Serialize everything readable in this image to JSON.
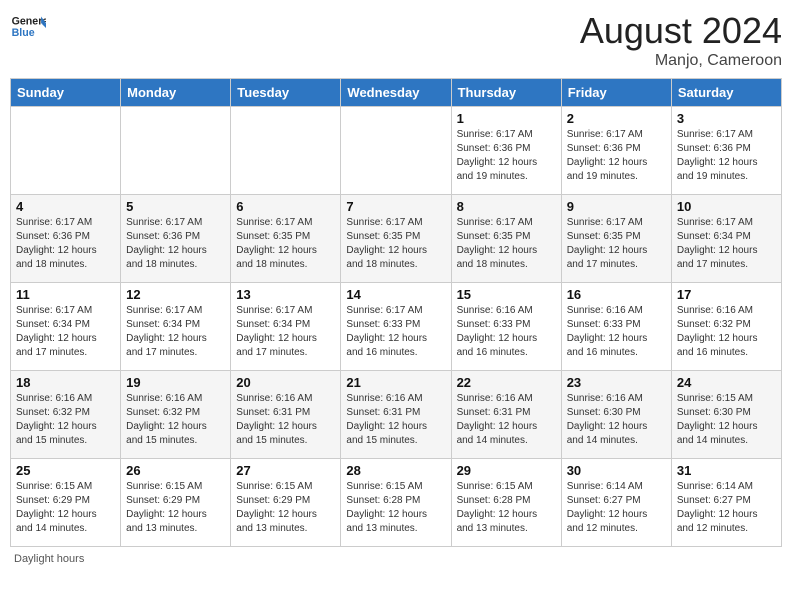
{
  "header": {
    "logo_general": "General",
    "logo_blue": "Blue",
    "month_year": "August 2024",
    "location": "Manjo, Cameroon"
  },
  "days_of_week": [
    "Sunday",
    "Monday",
    "Tuesday",
    "Wednesday",
    "Thursday",
    "Friday",
    "Saturday"
  ],
  "weeks": [
    [
      {
        "day": "",
        "info": ""
      },
      {
        "day": "",
        "info": ""
      },
      {
        "day": "",
        "info": ""
      },
      {
        "day": "",
        "info": ""
      },
      {
        "day": "1",
        "info": "Sunrise: 6:17 AM\nSunset: 6:36 PM\nDaylight: 12 hours\nand 19 minutes."
      },
      {
        "day": "2",
        "info": "Sunrise: 6:17 AM\nSunset: 6:36 PM\nDaylight: 12 hours\nand 19 minutes."
      },
      {
        "day": "3",
        "info": "Sunrise: 6:17 AM\nSunset: 6:36 PM\nDaylight: 12 hours\nand 19 minutes."
      }
    ],
    [
      {
        "day": "4",
        "info": "Sunrise: 6:17 AM\nSunset: 6:36 PM\nDaylight: 12 hours\nand 18 minutes."
      },
      {
        "day": "5",
        "info": "Sunrise: 6:17 AM\nSunset: 6:36 PM\nDaylight: 12 hours\nand 18 minutes."
      },
      {
        "day": "6",
        "info": "Sunrise: 6:17 AM\nSunset: 6:35 PM\nDaylight: 12 hours\nand 18 minutes."
      },
      {
        "day": "7",
        "info": "Sunrise: 6:17 AM\nSunset: 6:35 PM\nDaylight: 12 hours\nand 18 minutes."
      },
      {
        "day": "8",
        "info": "Sunrise: 6:17 AM\nSunset: 6:35 PM\nDaylight: 12 hours\nand 18 minutes."
      },
      {
        "day": "9",
        "info": "Sunrise: 6:17 AM\nSunset: 6:35 PM\nDaylight: 12 hours\nand 17 minutes."
      },
      {
        "day": "10",
        "info": "Sunrise: 6:17 AM\nSunset: 6:34 PM\nDaylight: 12 hours\nand 17 minutes."
      }
    ],
    [
      {
        "day": "11",
        "info": "Sunrise: 6:17 AM\nSunset: 6:34 PM\nDaylight: 12 hours\nand 17 minutes."
      },
      {
        "day": "12",
        "info": "Sunrise: 6:17 AM\nSunset: 6:34 PM\nDaylight: 12 hours\nand 17 minutes."
      },
      {
        "day": "13",
        "info": "Sunrise: 6:17 AM\nSunset: 6:34 PM\nDaylight: 12 hours\nand 17 minutes."
      },
      {
        "day": "14",
        "info": "Sunrise: 6:17 AM\nSunset: 6:33 PM\nDaylight: 12 hours\nand 16 minutes."
      },
      {
        "day": "15",
        "info": "Sunrise: 6:16 AM\nSunset: 6:33 PM\nDaylight: 12 hours\nand 16 minutes."
      },
      {
        "day": "16",
        "info": "Sunrise: 6:16 AM\nSunset: 6:33 PM\nDaylight: 12 hours\nand 16 minutes."
      },
      {
        "day": "17",
        "info": "Sunrise: 6:16 AM\nSunset: 6:32 PM\nDaylight: 12 hours\nand 16 minutes."
      }
    ],
    [
      {
        "day": "18",
        "info": "Sunrise: 6:16 AM\nSunset: 6:32 PM\nDaylight: 12 hours\nand 15 minutes."
      },
      {
        "day": "19",
        "info": "Sunrise: 6:16 AM\nSunset: 6:32 PM\nDaylight: 12 hours\nand 15 minutes."
      },
      {
        "day": "20",
        "info": "Sunrise: 6:16 AM\nSunset: 6:31 PM\nDaylight: 12 hours\nand 15 minutes."
      },
      {
        "day": "21",
        "info": "Sunrise: 6:16 AM\nSunset: 6:31 PM\nDaylight: 12 hours\nand 15 minutes."
      },
      {
        "day": "22",
        "info": "Sunrise: 6:16 AM\nSunset: 6:31 PM\nDaylight: 12 hours\nand 14 minutes."
      },
      {
        "day": "23",
        "info": "Sunrise: 6:16 AM\nSunset: 6:30 PM\nDaylight: 12 hours\nand 14 minutes."
      },
      {
        "day": "24",
        "info": "Sunrise: 6:15 AM\nSunset: 6:30 PM\nDaylight: 12 hours\nand 14 minutes."
      }
    ],
    [
      {
        "day": "25",
        "info": "Sunrise: 6:15 AM\nSunset: 6:29 PM\nDaylight: 12 hours\nand 14 minutes."
      },
      {
        "day": "26",
        "info": "Sunrise: 6:15 AM\nSunset: 6:29 PM\nDaylight: 12 hours\nand 13 minutes."
      },
      {
        "day": "27",
        "info": "Sunrise: 6:15 AM\nSunset: 6:29 PM\nDaylight: 12 hours\nand 13 minutes."
      },
      {
        "day": "28",
        "info": "Sunrise: 6:15 AM\nSunset: 6:28 PM\nDaylight: 12 hours\nand 13 minutes."
      },
      {
        "day": "29",
        "info": "Sunrise: 6:15 AM\nSunset: 6:28 PM\nDaylight: 12 hours\nand 13 minutes."
      },
      {
        "day": "30",
        "info": "Sunrise: 6:14 AM\nSunset: 6:27 PM\nDaylight: 12 hours\nand 12 minutes."
      },
      {
        "day": "31",
        "info": "Sunrise: 6:14 AM\nSunset: 6:27 PM\nDaylight: 12 hours\nand 12 minutes."
      }
    ]
  ],
  "footer": {
    "daylight_label": "Daylight hours"
  }
}
